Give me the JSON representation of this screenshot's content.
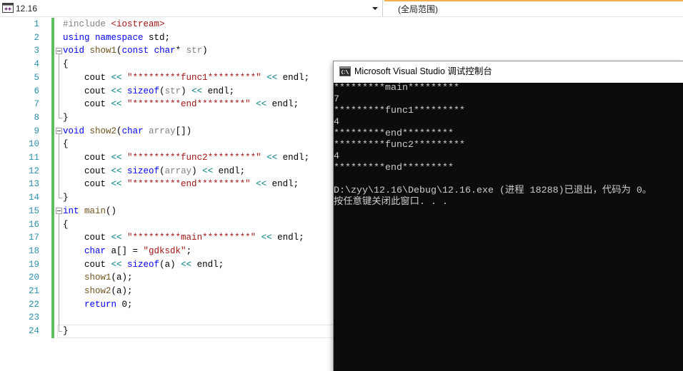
{
  "toolbar": {
    "project_dropdown": "12.16",
    "scope_dropdown": "(全局范围)"
  },
  "editor": {
    "lines": [
      {
        "number": "1",
        "tokens": [
          {
            "text": "#include ",
            "color": "#808080"
          },
          {
            "text": "<iostream>",
            "color": "#a31515"
          }
        ]
      },
      {
        "number": "2",
        "tokens": [
          {
            "text": "using",
            "color": "#0000ff"
          },
          {
            "text": " ",
            "color": "#000000"
          },
          {
            "text": "namespace",
            "color": "#0000ff"
          },
          {
            "text": " std;",
            "color": "#000000"
          }
        ]
      },
      {
        "number": "3",
        "fold": true,
        "tokens": [
          {
            "text": "void",
            "color": "#0000ff"
          },
          {
            "text": " ",
            "color": "#000000"
          },
          {
            "text": "show1",
            "color": "#74531f"
          },
          {
            "text": "(",
            "color": "#000000"
          },
          {
            "text": "const",
            "color": "#0000ff"
          },
          {
            "text": " ",
            "color": "#000000"
          },
          {
            "text": "char",
            "color": "#0000ff"
          },
          {
            "text": "* ",
            "color": "#000000"
          },
          {
            "text": "str",
            "color": "#808080"
          },
          {
            "text": ")",
            "color": "#000000"
          }
        ]
      },
      {
        "number": "4",
        "tokens": [
          {
            "text": "{",
            "color": "#000000"
          }
        ]
      },
      {
        "number": "5",
        "tokens": [
          {
            "text": "    cout ",
            "color": "#000000"
          },
          {
            "text": "<<",
            "color": "#008080"
          },
          {
            "text": " ",
            "color": "#000000"
          },
          {
            "text": "\"*********func1*********\"",
            "color": "#a31515"
          },
          {
            "text": " ",
            "color": "#000000"
          },
          {
            "text": "<<",
            "color": "#008080"
          },
          {
            "text": " endl;",
            "color": "#000000"
          }
        ]
      },
      {
        "number": "6",
        "tokens": [
          {
            "text": "    cout ",
            "color": "#000000"
          },
          {
            "text": "<<",
            "color": "#008080"
          },
          {
            "text": " ",
            "color": "#000000"
          },
          {
            "text": "sizeof",
            "color": "#0000ff"
          },
          {
            "text": "(",
            "color": "#000000"
          },
          {
            "text": "str",
            "color": "#808080"
          },
          {
            "text": ") ",
            "color": "#000000"
          },
          {
            "text": "<<",
            "color": "#008080"
          },
          {
            "text": " endl;",
            "color": "#000000"
          }
        ]
      },
      {
        "number": "7",
        "tokens": [
          {
            "text": "    cout ",
            "color": "#000000"
          },
          {
            "text": "<<",
            "color": "#008080"
          },
          {
            "text": " ",
            "color": "#000000"
          },
          {
            "text": "\"*********end*********\"",
            "color": "#a31515"
          },
          {
            "text": " ",
            "color": "#000000"
          },
          {
            "text": "<<",
            "color": "#008080"
          },
          {
            "text": " endl;",
            "color": "#000000"
          }
        ]
      },
      {
        "number": "8",
        "tokens": [
          {
            "text": "}",
            "color": "#000000"
          }
        ]
      },
      {
        "number": "9",
        "fold": true,
        "tokens": [
          {
            "text": "void",
            "color": "#0000ff"
          },
          {
            "text": " ",
            "color": "#000000"
          },
          {
            "text": "show2",
            "color": "#74531f"
          },
          {
            "text": "(",
            "color": "#000000"
          },
          {
            "text": "char",
            "color": "#0000ff"
          },
          {
            "text": " ",
            "color": "#000000"
          },
          {
            "text": "array",
            "color": "#808080"
          },
          {
            "text": "[])",
            "color": "#000000"
          }
        ]
      },
      {
        "number": "10",
        "tokens": [
          {
            "text": "{",
            "color": "#000000"
          }
        ]
      },
      {
        "number": "11",
        "tokens": [
          {
            "text": "    cout ",
            "color": "#000000"
          },
          {
            "text": "<<",
            "color": "#008080"
          },
          {
            "text": " ",
            "color": "#000000"
          },
          {
            "text": "\"*********func2*********\"",
            "color": "#a31515"
          },
          {
            "text": " ",
            "color": "#000000"
          },
          {
            "text": "<<",
            "color": "#008080"
          },
          {
            "text": " endl;",
            "color": "#000000"
          }
        ]
      },
      {
        "number": "12",
        "tokens": [
          {
            "text": "    cout ",
            "color": "#000000"
          },
          {
            "text": "<<",
            "color": "#008080"
          },
          {
            "text": " ",
            "color": "#000000"
          },
          {
            "text": "sizeof",
            "color": "#0000ff"
          },
          {
            "text": "(",
            "color": "#000000"
          },
          {
            "text": "array",
            "color": "#808080"
          },
          {
            "text": ") ",
            "color": "#000000"
          },
          {
            "text": "<<",
            "color": "#008080"
          },
          {
            "text": " endl;",
            "color": "#000000"
          }
        ]
      },
      {
        "number": "13",
        "tokens": [
          {
            "text": "    cout ",
            "color": "#000000"
          },
          {
            "text": "<<",
            "color": "#008080"
          },
          {
            "text": " ",
            "color": "#000000"
          },
          {
            "text": "\"*********end*********\"",
            "color": "#a31515"
          },
          {
            "text": " ",
            "color": "#000000"
          },
          {
            "text": "<<",
            "color": "#008080"
          },
          {
            "text": " endl;",
            "color": "#000000"
          }
        ]
      },
      {
        "number": "14",
        "tokens": [
          {
            "text": "}",
            "color": "#000000"
          }
        ]
      },
      {
        "number": "15",
        "fold": true,
        "tokens": [
          {
            "text": "int",
            "color": "#0000ff"
          },
          {
            "text": " ",
            "color": "#000000"
          },
          {
            "text": "main",
            "color": "#74531f"
          },
          {
            "text": "()",
            "color": "#000000"
          }
        ]
      },
      {
        "number": "16",
        "tokens": [
          {
            "text": "{",
            "color": "#000000"
          }
        ]
      },
      {
        "number": "17",
        "tokens": [
          {
            "text": "    cout ",
            "color": "#000000"
          },
          {
            "text": "<<",
            "color": "#008080"
          },
          {
            "text": " ",
            "color": "#000000"
          },
          {
            "text": "\"*********main*********\"",
            "color": "#a31515"
          },
          {
            "text": " ",
            "color": "#000000"
          },
          {
            "text": "<<",
            "color": "#008080"
          },
          {
            "text": " endl;",
            "color": "#000000"
          }
        ]
      },
      {
        "number": "18",
        "tokens": [
          {
            "text": "    ",
            "color": "#000000"
          },
          {
            "text": "char",
            "color": "#0000ff"
          },
          {
            "text": " a[] = ",
            "color": "#000000"
          },
          {
            "text": "\"gdksdk\"",
            "color": "#a31515"
          },
          {
            "text": ";",
            "color": "#000000"
          }
        ]
      },
      {
        "number": "19",
        "tokens": [
          {
            "text": "    cout ",
            "color": "#000000"
          },
          {
            "text": "<<",
            "color": "#008080"
          },
          {
            "text": " ",
            "color": "#000000"
          },
          {
            "text": "sizeof",
            "color": "#0000ff"
          },
          {
            "text": "(a) ",
            "color": "#000000"
          },
          {
            "text": "<<",
            "color": "#008080"
          },
          {
            "text": " endl;",
            "color": "#000000"
          }
        ]
      },
      {
        "number": "20",
        "tokens": [
          {
            "text": "    ",
            "color": "#000000"
          },
          {
            "text": "show1",
            "color": "#74531f"
          },
          {
            "text": "(a);",
            "color": "#000000"
          }
        ]
      },
      {
        "number": "21",
        "tokens": [
          {
            "text": "    ",
            "color": "#000000"
          },
          {
            "text": "show2",
            "color": "#74531f"
          },
          {
            "text": "(a);",
            "color": "#000000"
          }
        ]
      },
      {
        "number": "22",
        "tokens": [
          {
            "text": "    ",
            "color": "#000000"
          },
          {
            "text": "return",
            "color": "#0000ff"
          },
          {
            "text": " 0;",
            "color": "#000000"
          }
        ]
      },
      {
        "number": "23",
        "tokens": []
      },
      {
        "number": "24",
        "tokens": [
          {
            "text": "}",
            "color": "#000000"
          }
        ]
      }
    ]
  },
  "console": {
    "title": "Microsoft Visual Studio 调试控制台",
    "output": [
      "*********main*********",
      "7",
      "*********func1*********",
      "4",
      "*********end*********",
      "*********func2*********",
      "4",
      "*********end*********",
      "",
      "D:\\zyy\\12.16\\Debug\\12.16.exe (进程 18288)已退出，代码为 0。",
      "按任意键关闭此窗口. . ."
    ]
  }
}
